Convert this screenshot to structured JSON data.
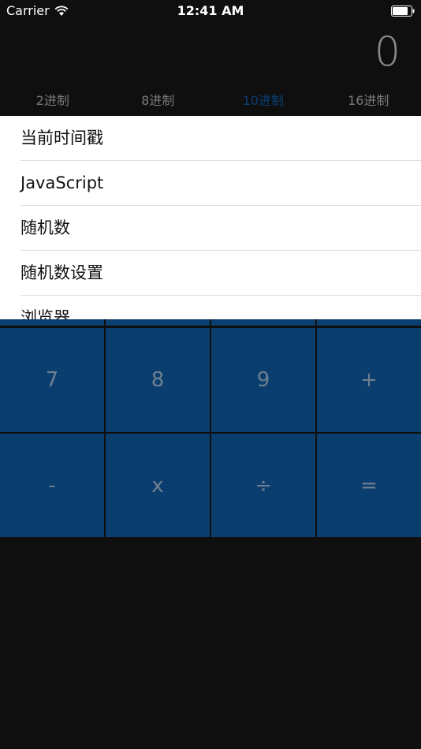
{
  "status_bar": {
    "carrier": "Carrier",
    "time": "12:41 AM"
  },
  "display": {
    "value": "0"
  },
  "base_tabs": [
    {
      "label": "2进制",
      "active": false
    },
    {
      "label": "8进制",
      "active": false
    },
    {
      "label": "10进制",
      "active": true
    },
    {
      "label": "16进制",
      "active": false
    }
  ],
  "menu": {
    "items": [
      "当前时间戳",
      "JavaScript",
      "随机数",
      "随机数设置",
      "浏览器"
    ]
  },
  "keypad": {
    "row1": [
      "7",
      "8",
      "9",
      "+"
    ],
    "row2": [
      "-",
      "x",
      "÷",
      "="
    ]
  },
  "colors": {
    "background": "#0f0f0f",
    "key": "#0a3e6e",
    "key_text": "#6f7f90",
    "active_tab": "#0a3e72",
    "inactive_tab": "#7a7a7a",
    "display_text": "#8a8a8a"
  }
}
